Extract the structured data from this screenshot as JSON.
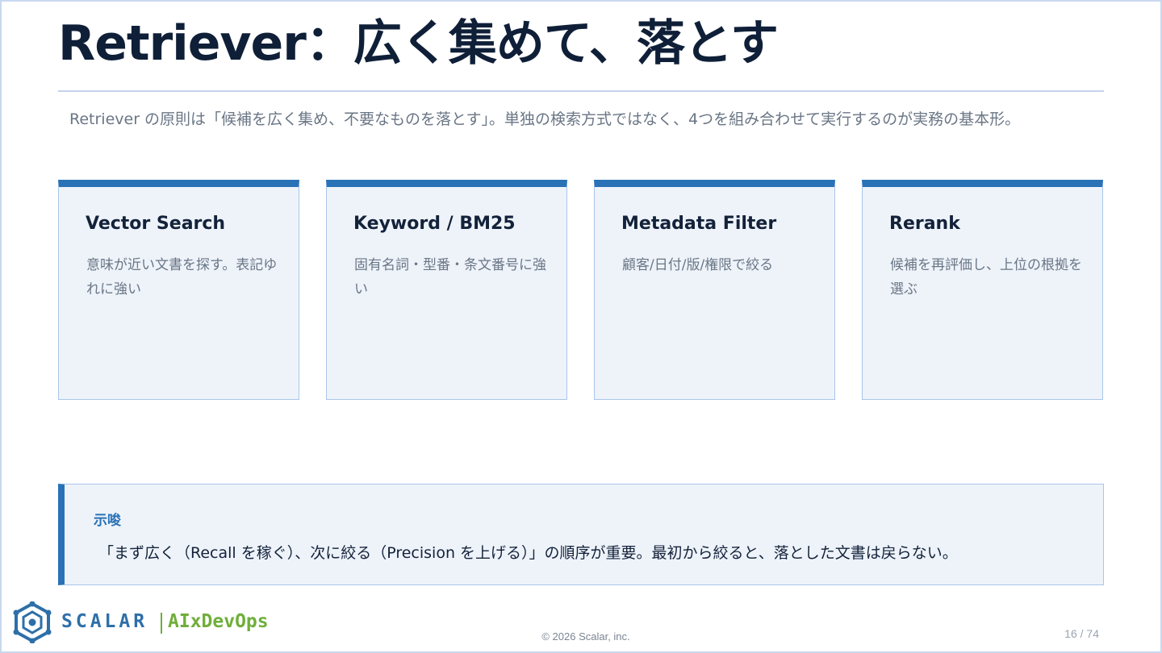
{
  "slide": {
    "title": "Retriever：広く集めて、落とす",
    "intro": "Retriever の原則は「候補を広く集め、不要なものを落とす」。単独の検索方式ではなく、4つを組み合わせて実行するのが実務の基本形。"
  },
  "cards": [
    {
      "title": "Vector Search",
      "desc": "意味が近い文書を探す。表記ゆれに強い"
    },
    {
      "title": "Keyword / BM25",
      "desc": "固有名詞・型番・条文番号に強い"
    },
    {
      "title": "Metadata Filter",
      "desc": "顧客/日付/版/権限で絞る"
    },
    {
      "title": "Rerank",
      "desc": "候補を再評価し、上位の根拠を選ぶ"
    }
  ],
  "note": {
    "label": "示唆",
    "text": "「まず広く（Recall を稼ぐ）、次に絞る（Precision を上げる）」の順序が重要。最初から絞ると、落とした文書は戻らない。"
  },
  "footer": {
    "brand": "SCALAR",
    "sub_brand": "AIxDevOps",
    "copyright": "© 2026 Scalar, inc.",
    "page": "16 / 74"
  },
  "colors": {
    "accent": "#2a72b6",
    "card_bg": "#eef3fa",
    "brand_blue": "#2e6fa8",
    "brand_green": "#6fae3a"
  }
}
